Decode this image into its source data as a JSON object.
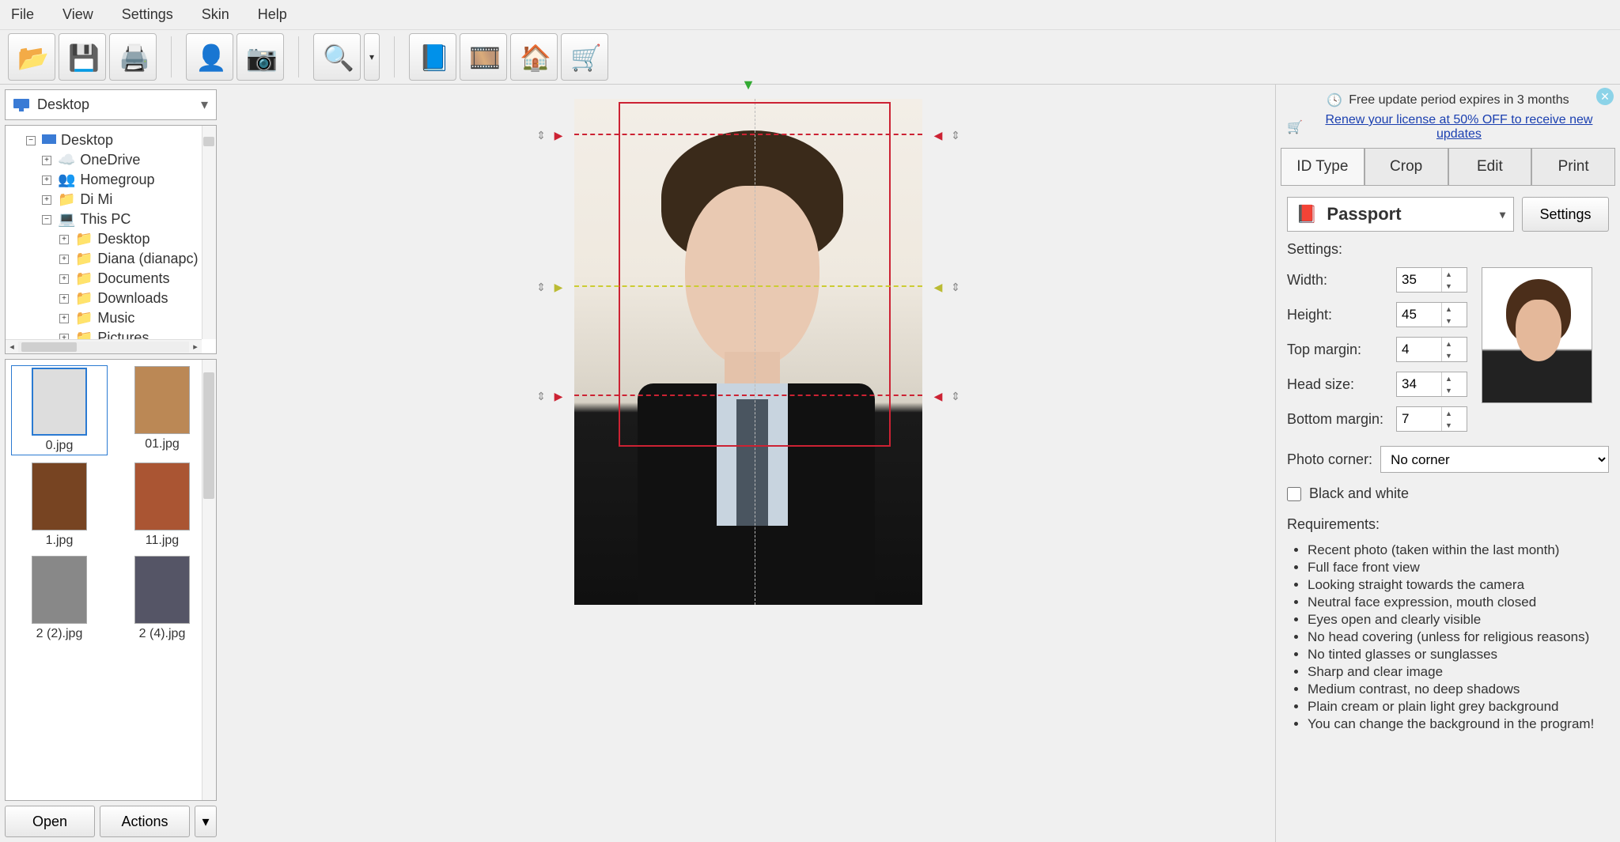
{
  "menu": {
    "items": [
      "File",
      "View",
      "Settings",
      "Skin",
      "Help"
    ]
  },
  "promo": {
    "line1": "Free update period expires in 3 months",
    "line2": "Renew your license at 50% OFF to receive new updates"
  },
  "location_combo": "Desktop",
  "tree": {
    "root": "Desktop",
    "items": [
      {
        "label": "OneDrive",
        "exp": "+"
      },
      {
        "label": "Homegroup",
        "exp": "+"
      },
      {
        "label": "Di Mi",
        "exp": "+"
      },
      {
        "label": "This PC",
        "exp": "−",
        "children": [
          {
            "label": "Desktop",
            "exp": "+"
          },
          {
            "label": "Diana (dianapc)",
            "exp": "+"
          },
          {
            "label": "Documents",
            "exp": "+"
          },
          {
            "label": "Downloads",
            "exp": "+"
          },
          {
            "label": "Music",
            "exp": "+"
          },
          {
            "label": "Pictures",
            "exp": "+"
          }
        ]
      }
    ]
  },
  "thumbs": [
    {
      "label": "0.jpg",
      "selected": true
    },
    {
      "label": "01.jpg",
      "selected": false
    },
    {
      "label": "1.jpg",
      "selected": false
    },
    {
      "label": "11.jpg",
      "selected": false
    },
    {
      "label": "2 (2).jpg",
      "selected": false
    },
    {
      "label": "2 (4).jpg",
      "selected": false
    }
  ],
  "buttons": {
    "open": "Open",
    "actions": "Actions"
  },
  "tabs": {
    "items": [
      "ID Type",
      "Crop",
      "Edit",
      "Print"
    ],
    "active": 0
  },
  "idtype": {
    "combo": "Passport",
    "settings_btn": "Settings",
    "settings_label": "Settings:",
    "fields": {
      "width": {
        "label": "Width:",
        "value": "35"
      },
      "height": {
        "label": "Height:",
        "value": "45"
      },
      "top_margin": {
        "label": "Top margin:",
        "value": "4"
      },
      "head_size": {
        "label": "Head size:",
        "value": "34"
      },
      "bottom_margin": {
        "label": "Bottom margin:",
        "value": "7"
      }
    },
    "photo_corner_label": "Photo corner:",
    "photo_corner_value": "No corner",
    "bw_label": "Black and white",
    "req_title": "Requirements:",
    "requirements": [
      "Recent photo (taken within the last month)",
      "Full face front view",
      "Looking straight towards the camera",
      "Neutral face expression, mouth closed",
      "Eyes open and clearly visible",
      "No head covering (unless for religious reasons)",
      "No tinted glasses or sunglasses",
      "Sharp and clear image",
      "Medium contrast, no deep shadows",
      "Plain cream or plain light grey background",
      "You can change the background in the program!"
    ]
  }
}
